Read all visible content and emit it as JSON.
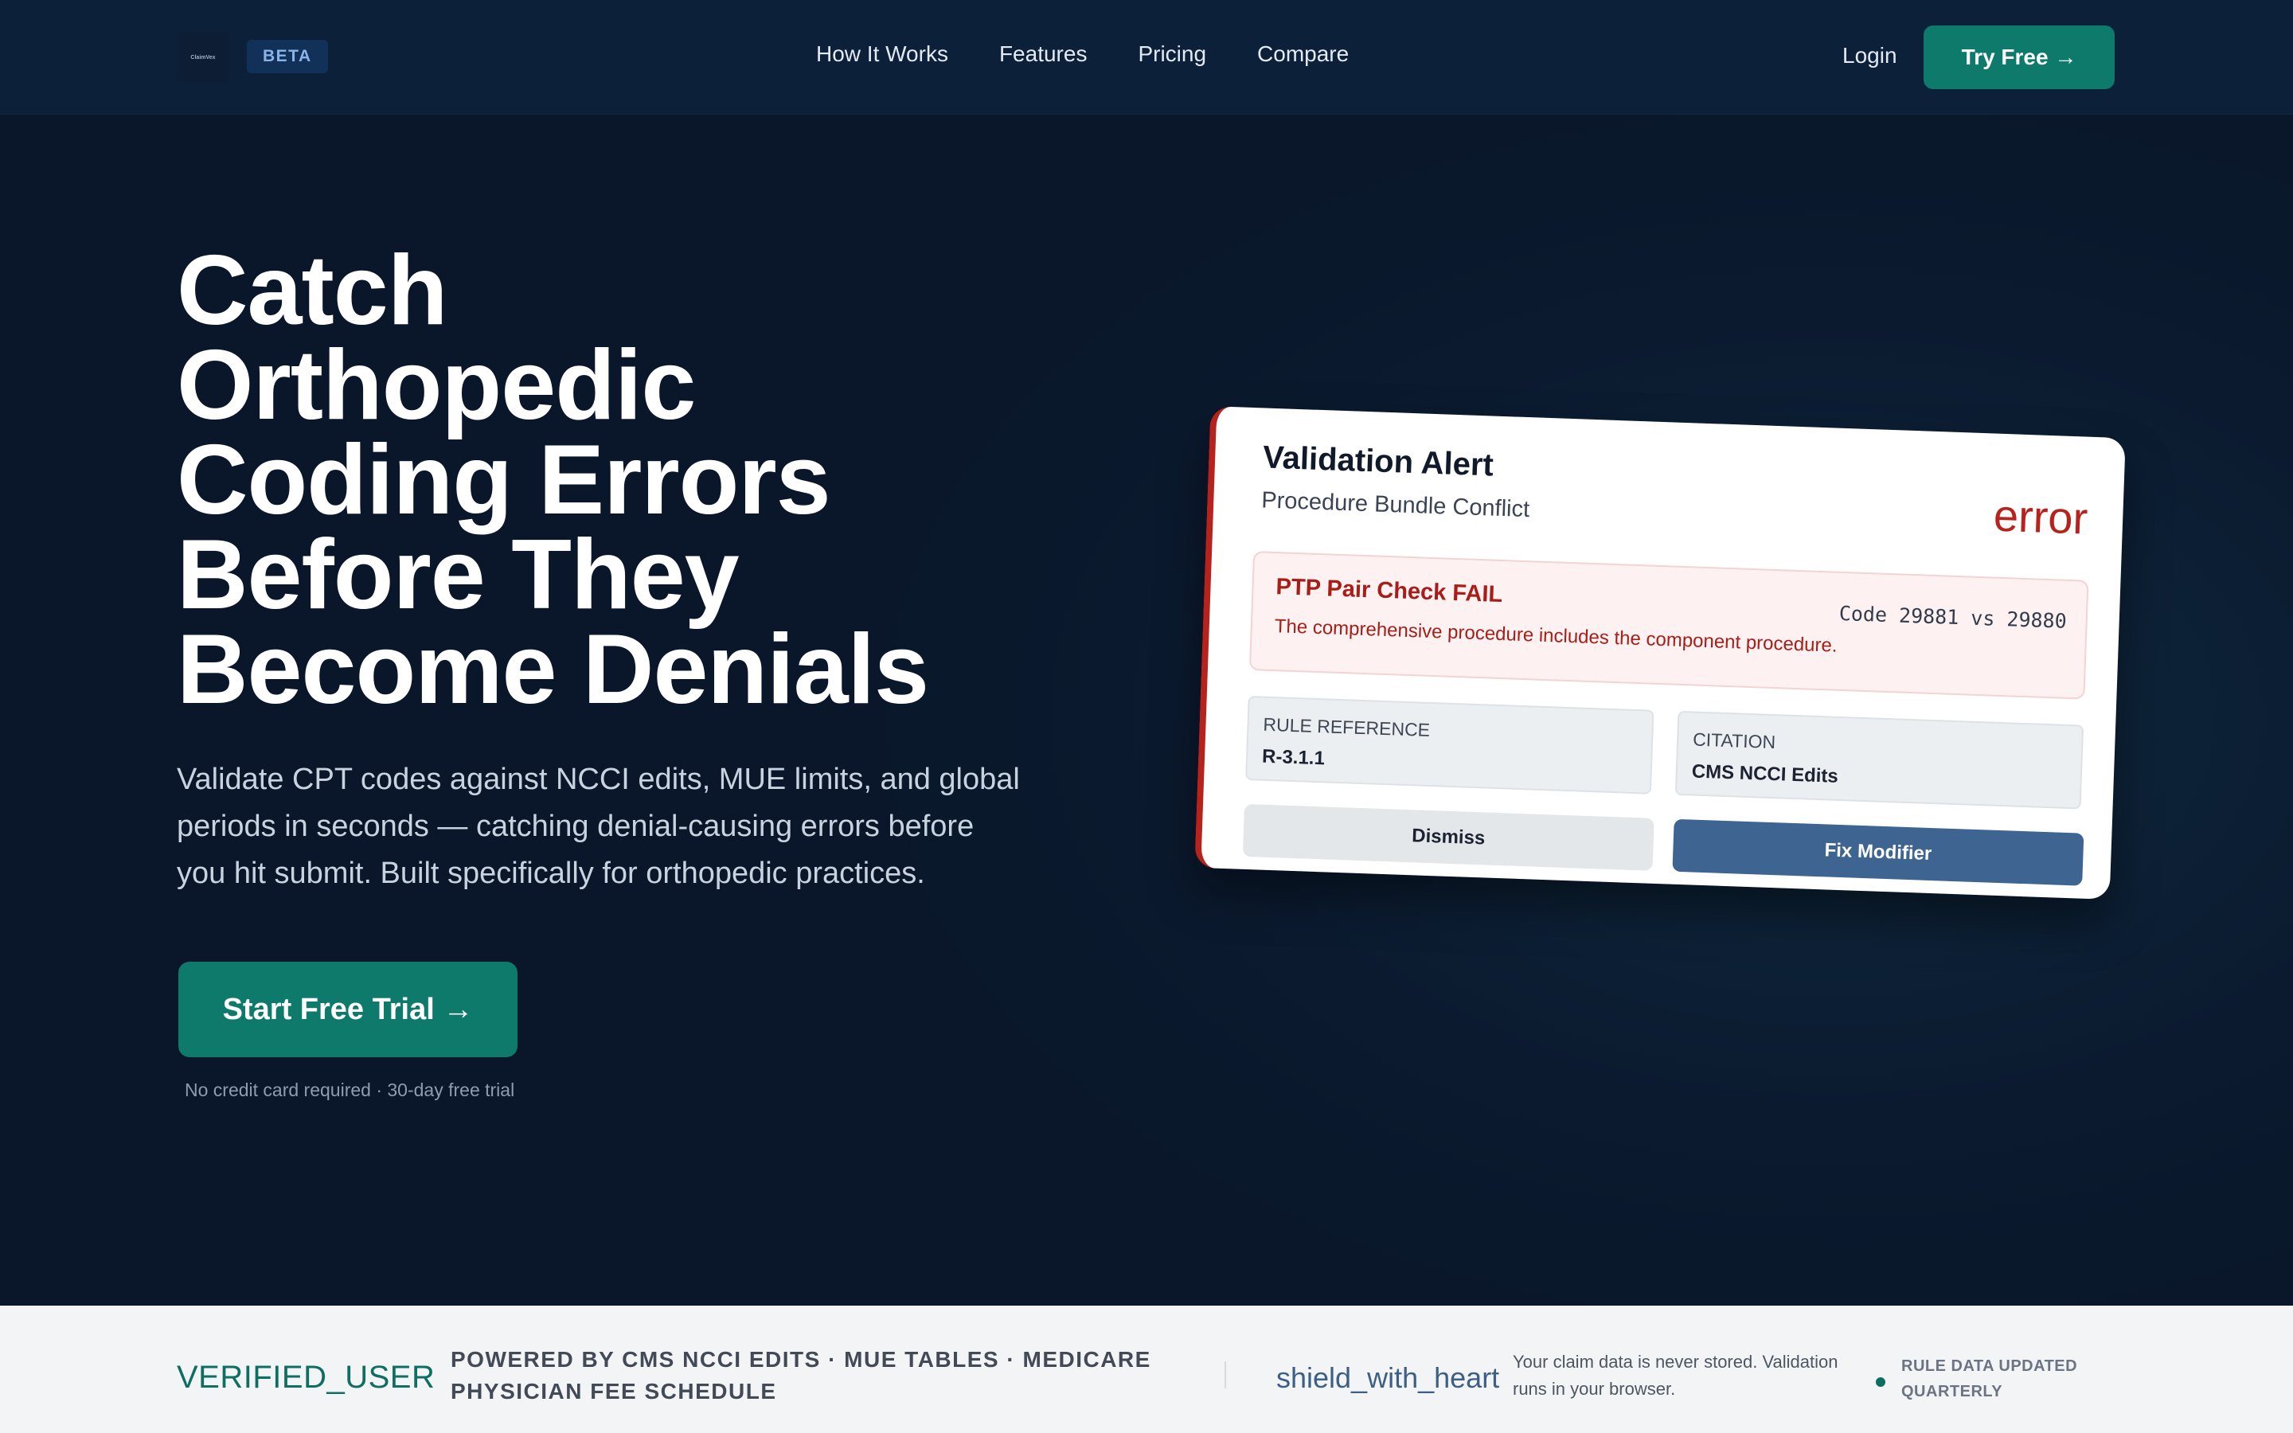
{
  "nav": {
    "logo_text": "ClaimVex",
    "beta_badge": "BETA",
    "links": [
      "How It Works",
      "Features",
      "Pricing",
      "Compare"
    ],
    "login": "Login",
    "try_free": "Try Free →"
  },
  "hero": {
    "title_lines": [
      "Catch",
      "Orthopedic",
      "Coding Errors",
      "Before They",
      "Become Denials"
    ],
    "subtitle": "Validate CPT codes against NCCI edits, MUE limits, and global periods in seconds — catching denial-causing errors before you hit submit. Built specifically for orthopedic practices.",
    "cta": "Start Free Trial →",
    "cta_note": "No credit card required · 30-day free trial"
  },
  "card": {
    "title": "Validation Alert",
    "subtitle": "Procedure Bundle Conflict",
    "status": "error",
    "alert_title": "PTP Pair Check FAIL",
    "alert_code": "Code 29881 vs 29880",
    "alert_message": "The comprehensive procedure includes the component procedure.",
    "rule_reference_label": "RULE REFERENCE",
    "rule_reference_value": "R-3.1.1",
    "citation_label": "CITATION",
    "citation_value": "CMS NCCI Edits",
    "dismiss": "Dismiss",
    "fix": "Fix Modifier"
  },
  "trust_bar": {
    "icon1": "VERIFIED_USER",
    "powered_by": "POWERED BY CMS NCCI EDITS · MUE TABLES · MEDICARE PHYSICIAN FEE SCHEDULE",
    "icon2": "shield_with_heart",
    "privacy": "Your claim data is never stored. Validation runs in your browser.",
    "updated": "RULE DATA UPDATED QUARTERLY"
  },
  "colors": {
    "background": "#0b1a2f",
    "accent": "#0d7a6c",
    "error": "#b8221c",
    "fix_button": "#3e6591"
  }
}
